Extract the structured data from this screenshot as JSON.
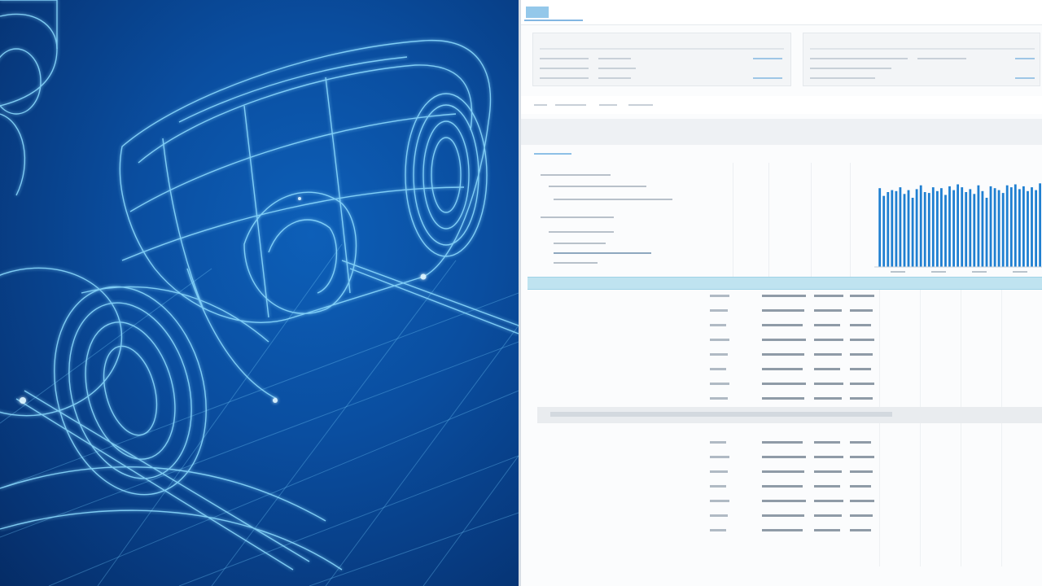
{
  "dashboard": {
    "title": "",
    "panels": [
      {
        "header_left": "",
        "header_right": "",
        "rows": []
      },
      {
        "header_left": "",
        "header_right": "",
        "rows": []
      }
    ],
    "tabs": [],
    "section_title": "",
    "tree_rows": [],
    "table": {
      "rows": 15
    }
  },
  "chart_data": {
    "type": "bar",
    "values": [
      0.82,
      0.74,
      0.78,
      0.8,
      0.79,
      0.83,
      0.76,
      0.8,
      0.72,
      0.81,
      0.85,
      0.78,
      0.77,
      0.83,
      0.79,
      0.82,
      0.75,
      0.84,
      0.8,
      0.86,
      0.83,
      0.78,
      0.81,
      0.76,
      0.85,
      0.79,
      0.72,
      0.84,
      0.82,
      0.8,
      0.77,
      0.85,
      0.83,
      0.86,
      0.81,
      0.84,
      0.79,
      0.83,
      0.8,
      0.87
    ],
    "ylim": [
      0,
      1
    ],
    "color": "#1f7fd1"
  },
  "colors": {
    "render_bg": "#0a4ea0",
    "wire": "#7fd3ff",
    "accent": "#2f86cf",
    "highlight": "#bfe3f0"
  }
}
